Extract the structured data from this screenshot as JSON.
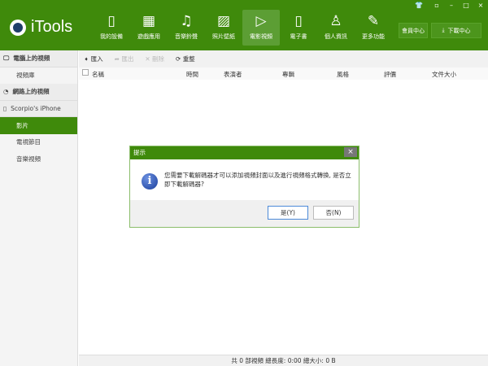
{
  "app": {
    "title": "iTools"
  },
  "window_controls": [
    "skin-icon",
    "mini-icon",
    "minimize-icon",
    "maximize-icon",
    "close-icon"
  ],
  "nav": [
    {
      "label": "我的設備",
      "icon": "phone-icon",
      "glyph": "▯"
    },
    {
      "label": "遊戲應用",
      "icon": "apps-icon",
      "glyph": "▦"
    },
    {
      "label": "音樂鈴聲",
      "icon": "music-icon",
      "glyph": "♫"
    },
    {
      "label": "照片壁紙",
      "icon": "photo-icon",
      "glyph": "▨"
    },
    {
      "label": "電影視頻",
      "icon": "play-icon",
      "glyph": "▷",
      "selected": true
    },
    {
      "label": "電子書",
      "icon": "book-icon",
      "glyph": "▯"
    },
    {
      "label": "個人資訊",
      "icon": "person-icon",
      "glyph": "♙"
    },
    {
      "label": "更多功能",
      "icon": "wrench-icon",
      "glyph": "✎"
    }
  ],
  "top_buttons": {
    "member": "會員中心",
    "download": "下載中心"
  },
  "sidebar": {
    "groups": [
      {
        "label": "電腦上的視頻",
        "items": [
          "視頻庫"
        ]
      },
      {
        "label": "網路上的視頻",
        "items": []
      },
      {
        "label": "Scorpio's iPhone",
        "items": [
          "影片",
          "電視節目",
          "音樂視頻"
        ],
        "selected": "影片"
      }
    ]
  },
  "toolbar": {
    "import": "匯入",
    "export": "匯出",
    "delete": "刪除",
    "refresh": "重整"
  },
  "columns": [
    "名稱",
    "時間",
    "表演者",
    "專輯",
    "風格",
    "評價",
    "文件大小"
  ],
  "status": "共 0 部視頻   總長度: 0:00   總大小: 0 B",
  "dialog": {
    "title": "提示",
    "message": "您需要下載解碼器才可以添加視頻封面以及進行視頻格式轉換, 是否立即下載解碼器?",
    "yes": "是(Y)",
    "no": "否(N)"
  },
  "colors": {
    "brand": "#3f8a0b",
    "selected_nav": "#5c9e34"
  }
}
